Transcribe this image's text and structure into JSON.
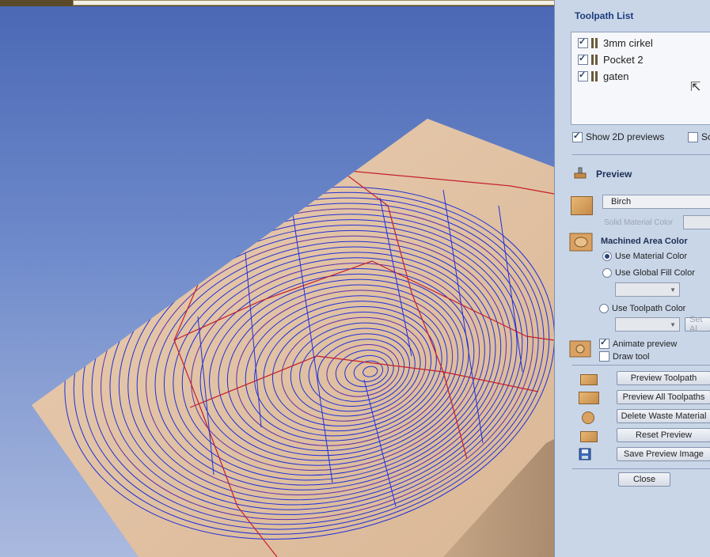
{
  "toolpath_list": {
    "title": "Toolpath List",
    "items": [
      {
        "name": "3mm cirkel",
        "checked": true
      },
      {
        "name": "Pocket 2",
        "checked": true
      },
      {
        "name": "gaten",
        "checked": true
      }
    ],
    "show_2d_previews": {
      "label": "Show 2D previews",
      "checked": true
    },
    "second_option": {
      "label": "Sc",
      "checked": false
    }
  },
  "preview": {
    "title": "Preview",
    "material": "Birch",
    "solid_material_color_label": "Solid Material Color",
    "machined_area": {
      "title": "Machined Area Color",
      "use_material": "Use Material Color",
      "use_global": "Use Global Fill Color",
      "use_toolpath": "Use Toolpath Color",
      "selected": "use_material",
      "set_all": "Set Al"
    },
    "animate_preview": {
      "label": "Animate preview",
      "checked": true
    },
    "draw_tool": {
      "label": "Draw tool",
      "checked": false
    },
    "buttons": {
      "preview_toolpath": "Preview Toolpath",
      "preview_all": "Preview All Toolpaths",
      "delete_waste": "Delete Waste Material",
      "reset_preview": "Reset Preview",
      "save_preview": "Save Preview Image",
      "close": "Close"
    }
  },
  "colors": {
    "panel_bg": "#c9d6e8",
    "toolpath_blue": "#1f2fd8",
    "boundary_red": "#c4202a",
    "wood": "#e3c3a3"
  },
  "icons": [
    "preview-icon",
    "wood-material-icon",
    "machined-area-icon",
    "tool-icon",
    "save-icon"
  ]
}
